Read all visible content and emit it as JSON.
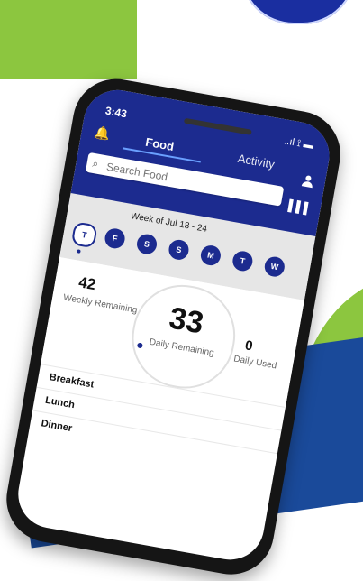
{
  "status_bar": {
    "time": "3:43",
    "signal_text": "..ıl ⟟ ▬"
  },
  "header": {
    "tab_food": "Food",
    "tab_activity": "Activity"
  },
  "search": {
    "placeholder": "Search Food"
  },
  "week": {
    "label": "Week of Jul 18 - 24",
    "days": [
      "T",
      "F",
      "S",
      "S",
      "M",
      "T",
      "W"
    ]
  },
  "summary": {
    "weekly_value": "42",
    "weekly_label": "Weekly Remaining",
    "daily_value": "33",
    "daily_label": "Daily Remaining",
    "used_value": "0",
    "used_label": "Daily Used"
  },
  "meals": [
    "Breakfast",
    "Lunch",
    "Dinner"
  ],
  "colors": {
    "brand_blue": "#1c2b8f",
    "green": "#8cc63f",
    "wave_blue": "#1a4a9a"
  }
}
